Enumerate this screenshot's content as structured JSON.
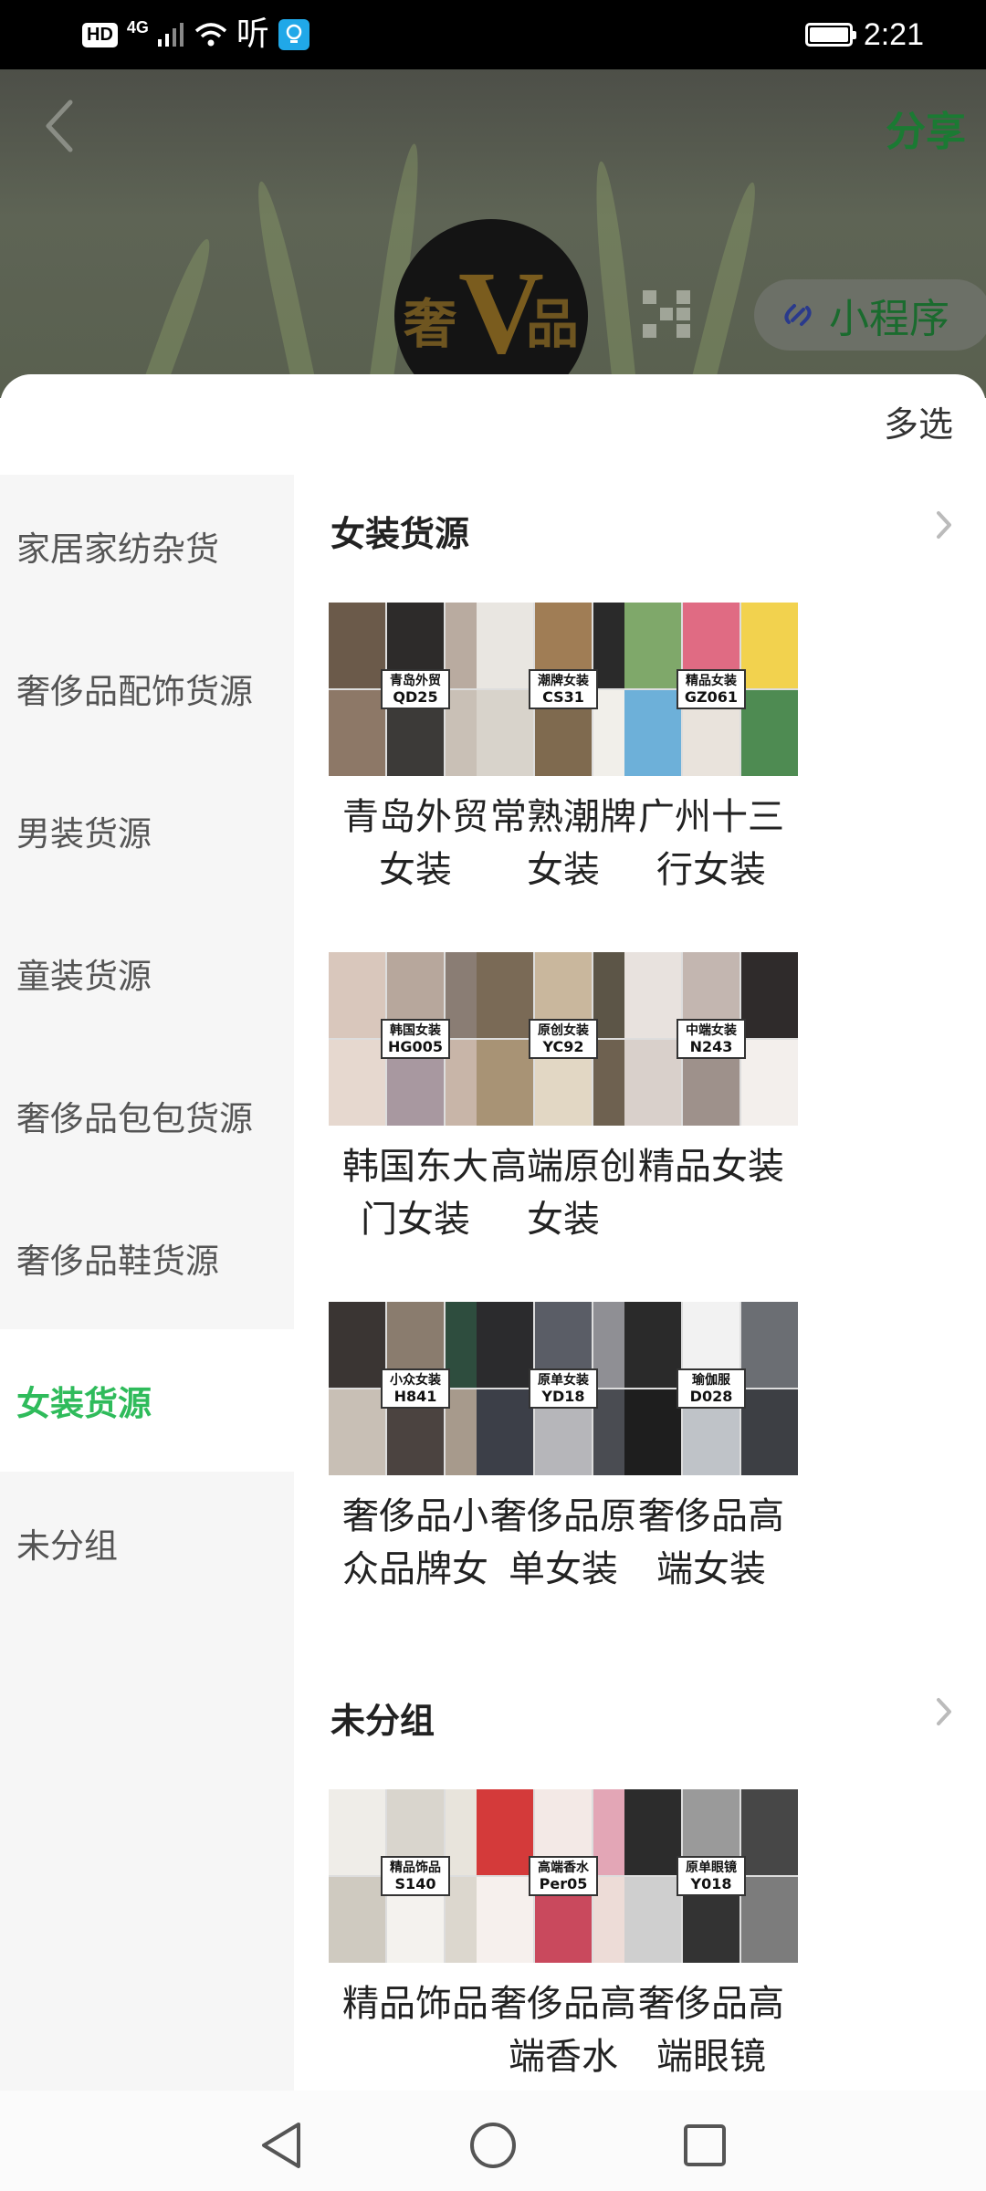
{
  "status_bar": {
    "hd": "HD",
    "network": "4G",
    "app_text": "听",
    "time": "2:21"
  },
  "header": {
    "share_label": "分享",
    "logo_left": "奢",
    "logo_v": "V",
    "logo_right": "品",
    "mini_program_label": "小程序"
  },
  "sheet": {
    "multi_select_label": "多选"
  },
  "sidebar": {
    "active_index": 6,
    "items": [
      {
        "label": "家居家纺杂货"
      },
      {
        "label": "奢侈品配饰货源"
      },
      {
        "label": "男装货源"
      },
      {
        "label": "童装货源"
      },
      {
        "label": "奢侈品包包货源"
      },
      {
        "label": "奢侈品鞋货源"
      },
      {
        "label": "女装货源"
      },
      {
        "label": "未分组"
      }
    ]
  },
  "sections": [
    {
      "title": "女装货源",
      "items": [
        {
          "tag": "青岛外贸",
          "code": "QD25",
          "label": "青岛外贸女装",
          "colors": [
            "#6b5a4a",
            "#2d2b2a",
            "#b9aba0",
            "#8d7867",
            "#3c3a38",
            "#c9c0b6"
          ]
        },
        {
          "tag": "潮牌女装",
          "code": "CS31",
          "label": "常熟潮牌女装",
          "colors": [
            "#e9e6e1",
            "#a07d55",
            "#2a2a2a",
            "#d8d3cb",
            "#7f6a4f",
            "#f1efea"
          ]
        },
        {
          "tag": "精品女装",
          "code": "GZ061",
          "label": "广州十三行女装",
          "colors": [
            "#7fa86a",
            "#e06b83",
            "#f2d24e",
            "#6db0d9",
            "#e9e3dc",
            "#4e8b52"
          ]
        },
        {
          "tag": "韩国女装",
          "code": "HG005",
          "label": "韩国东大门女装",
          "colors": [
            "#d9c7bc",
            "#b7a79c",
            "#8a7d74",
            "#e6d8cf",
            "#a898a0",
            "#c8b5a8"
          ]
        },
        {
          "tag": "原创女装",
          "code": "YC92",
          "label": "高端原创女装",
          "colors": [
            "#7a6a56",
            "#c9b79d",
            "#5c5547",
            "#a89375",
            "#e2d7c4",
            "#6e6150"
          ]
        },
        {
          "tag": "中端女装",
          "code": "N243",
          "label": "精品女装",
          "colors": [
            "#e8e2de",
            "#c3b6b0",
            "#2f2b2b",
            "#d9d0cb",
            "#9e918b",
            "#f3efec"
          ]
        },
        {
          "tag": "小众女装",
          "code": "H841",
          "label": "奢侈品小众品牌女装",
          "colors": [
            "#3a3533",
            "#8a7c6e",
            "#2e4d3e",
            "#c8bfb5",
            "#4b4340",
            "#a79a8c"
          ]
        },
        {
          "tag": "原单女装",
          "code": "YD18",
          "label": "奢侈品原单女装",
          "colors": [
            "#2b2b2d",
            "#5a5d66",
            "#8f8f94",
            "#3c3f48",
            "#b6b6ba",
            "#4a4c52"
          ]
        },
        {
          "tag": "瑜伽服",
          "code": "D028",
          "label": "奢侈品高端女装",
          "colors": [
            "#2a2a2a",
            "#f2f2f2",
            "#6b6e73",
            "#1e1e1e",
            "#bfc3c8",
            "#3d3f44"
          ]
        }
      ]
    },
    {
      "title": "未分组",
      "items": [
        {
          "tag": "精品饰品",
          "code": "S140",
          "label": "精品饰品",
          "colors": [
            "#efede8",
            "#d9d5cd",
            "#e8e4dc",
            "#cfcac0",
            "#f4f2ee",
            "#dcd7ce"
          ]
        },
        {
          "tag": "高端香水",
          "code": "Per05",
          "label": "奢侈品高端香水",
          "colors": [
            "#d43a3a",
            "#f3e9e6",
            "#e3a6b6",
            "#f6f0ed",
            "#c9495d",
            "#eddcd7"
          ]
        },
        {
          "tag": "原单眼镜",
          "code": "Y018",
          "label": "奢侈品高端眼镜",
          "colors": [
            "#2c2c2c",
            "#9a9a9a",
            "#474747",
            "#cfcfcf",
            "#333333",
            "#7c7c7c"
          ]
        }
      ]
    }
  ],
  "nav_bar": {
    "icons": [
      "back-triangle",
      "home-circle",
      "recents-square"
    ]
  }
}
